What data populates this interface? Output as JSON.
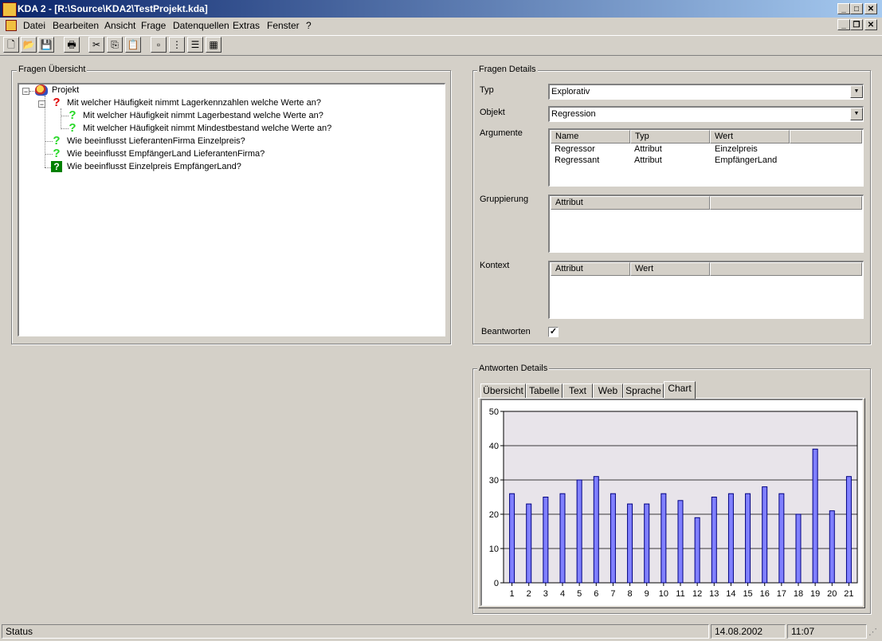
{
  "window": {
    "title": "KDA 2 - [R:\\Source\\KDA2\\TestProjekt.kda]",
    "caption_buttons": {
      "minimize": "_",
      "maximize": "□",
      "close": "✕",
      "restore": "❐"
    }
  },
  "menu": {
    "items": [
      "Datei",
      "Bearbeiten",
      "Ansicht",
      "Frage",
      "Datenquellen",
      "Extras",
      "Fenster",
      "?"
    ],
    "mnemonics": [
      "D",
      "B",
      "A",
      "F",
      "n",
      "E",
      "F",
      "?"
    ]
  },
  "toolbar": {
    "buttons": [
      "new-icon",
      "open-icon",
      "save-icon",
      "print-icon",
      "cut-icon",
      "copy-icon",
      "paste-icon",
      "small-icons-icon",
      "tree-view-icon",
      "list-view-icon",
      "details-view-icon"
    ]
  },
  "fragen_uebersicht": {
    "title": "Fragen Übersicht",
    "root": "Projekt",
    "items": [
      "Mit welcher Häufigkeit nimmt Lagerkennzahlen welche Werte an?",
      "Mit welcher Häufigkeit nimmt Lagerbestand welche Werte an?",
      "Mit welcher Häufigkeit nimmt Mindestbestand welche Werte an?",
      "Wie beeinflusst LieferantenFirma Einzelpreis?",
      "Wie beeinflusst EmpfängerLand LieferantenFirma?",
      "Wie beeinflusst Einzelpreis EmpfängerLand?"
    ]
  },
  "fragen_details": {
    "title": "Fragen Details",
    "typ_label": "Typ",
    "typ_value": "Explorativ",
    "objekt_label": "Objekt",
    "objekt_value": "Regression",
    "argumente_label": "Argumente",
    "argumente_columns": [
      "Name",
      "Typ",
      "Wert"
    ],
    "argumente_rows": [
      [
        "Regressor",
        "Attribut",
        "Einzelpreis"
      ],
      [
        "Regressant",
        "Attribut",
        "EmpfängerLand"
      ]
    ],
    "gruppierung_label": "Gruppierung",
    "gruppierung_columns": [
      "Attribut"
    ],
    "kontext_label": "Kontext",
    "kontext_columns": [
      "Attribut",
      "Wert"
    ],
    "beantworten_label": "Beantworten",
    "beantworten_checked": true
  },
  "antworten_details": {
    "title": "Antworten Details",
    "tabs": [
      "Übersicht",
      "Tabelle",
      "Text",
      "Web",
      "Sprache",
      "Chart"
    ],
    "active_tab": "Chart"
  },
  "chart_data": {
    "type": "bar",
    "categories": [
      "1",
      "2",
      "3",
      "4",
      "5",
      "6",
      "7",
      "8",
      "9",
      "10",
      "11",
      "12",
      "13",
      "14",
      "15",
      "16",
      "17",
      "18",
      "19",
      "20",
      "21"
    ],
    "values": [
      26,
      23,
      25,
      26,
      30,
      31,
      26,
      23,
      23,
      26,
      24,
      19,
      25,
      26,
      26,
      28,
      26,
      20,
      39,
      21,
      31
    ],
    "ylim": [
      0,
      50
    ],
    "yticks": [
      0,
      10,
      20,
      30,
      40,
      50
    ],
    "grid": true,
    "bar_color": "#8080ff",
    "plot_background": "#e8e4ea"
  },
  "statusbar": {
    "status": "Status",
    "date": "14.08.2002",
    "time": "11:07"
  },
  "colors": {
    "titlebar_start": "#0a246a",
    "titlebar_end": "#a6caf0",
    "face": "#d4d0c8"
  }
}
